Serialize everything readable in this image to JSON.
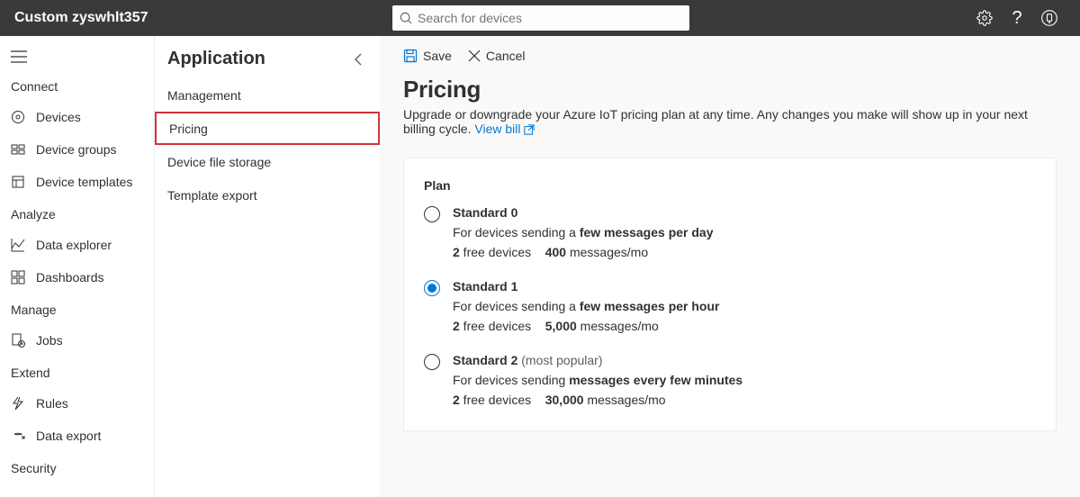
{
  "topbar": {
    "title": "Custom zyswhlt357",
    "searchPlaceholder": "Search for devices"
  },
  "sidebar": {
    "sections": [
      {
        "label": "Connect",
        "items": [
          {
            "label": "Devices",
            "icon": "devices-icon"
          },
          {
            "label": "Device groups",
            "icon": "device-groups-icon"
          },
          {
            "label": "Device templates",
            "icon": "device-templates-icon"
          }
        ]
      },
      {
        "label": "Analyze",
        "items": [
          {
            "label": "Data explorer",
            "icon": "data-explorer-icon"
          },
          {
            "label": "Dashboards",
            "icon": "dashboard-icon"
          }
        ]
      },
      {
        "label": "Manage",
        "items": [
          {
            "label": "Jobs",
            "icon": "jobs-icon"
          }
        ]
      },
      {
        "label": "Extend",
        "items": [
          {
            "label": "Rules",
            "icon": "rules-icon"
          },
          {
            "label": "Data export",
            "icon": "data-export-icon"
          }
        ]
      },
      {
        "label": "Security",
        "items": []
      }
    ]
  },
  "col2": {
    "title": "Application",
    "items": [
      "Management",
      "Pricing",
      "Device file storage",
      "Template export"
    ],
    "activeIndex": 1
  },
  "toolbar": {
    "save": "Save",
    "cancel": "Cancel"
  },
  "page": {
    "title": "Pricing",
    "subtitle": "Upgrade or downgrade your Azure IoT pricing plan at any time. Any changes you make will show up in your next billing cycle. ",
    "viewBill": "View bill"
  },
  "plans": {
    "label": "Plan",
    "selectedIndex": 1,
    "options": [
      {
        "name": "Standard 0",
        "tag": "",
        "desc_pre": "For devices sending a ",
        "desc_bold": "few messages per day",
        "quota_bold1": "2",
        "quota_txt1": " free devices",
        "quota_bold2": "400",
        "quota_txt2": " messages/mo"
      },
      {
        "name": "Standard 1",
        "tag": "",
        "desc_pre": "For devices sending a ",
        "desc_bold": "few messages per hour",
        "quota_bold1": "2",
        "quota_txt1": " free devices",
        "quota_bold2": "5,000",
        "quota_txt2": " messages/mo"
      },
      {
        "name": "Standard 2",
        "tag": " (most popular)",
        "desc_pre": "For devices sending ",
        "desc_bold": "messages every few minutes",
        "quota_bold1": "2",
        "quota_txt1": " free devices",
        "quota_bold2": "30,000",
        "quota_txt2": " messages/mo"
      }
    ]
  }
}
